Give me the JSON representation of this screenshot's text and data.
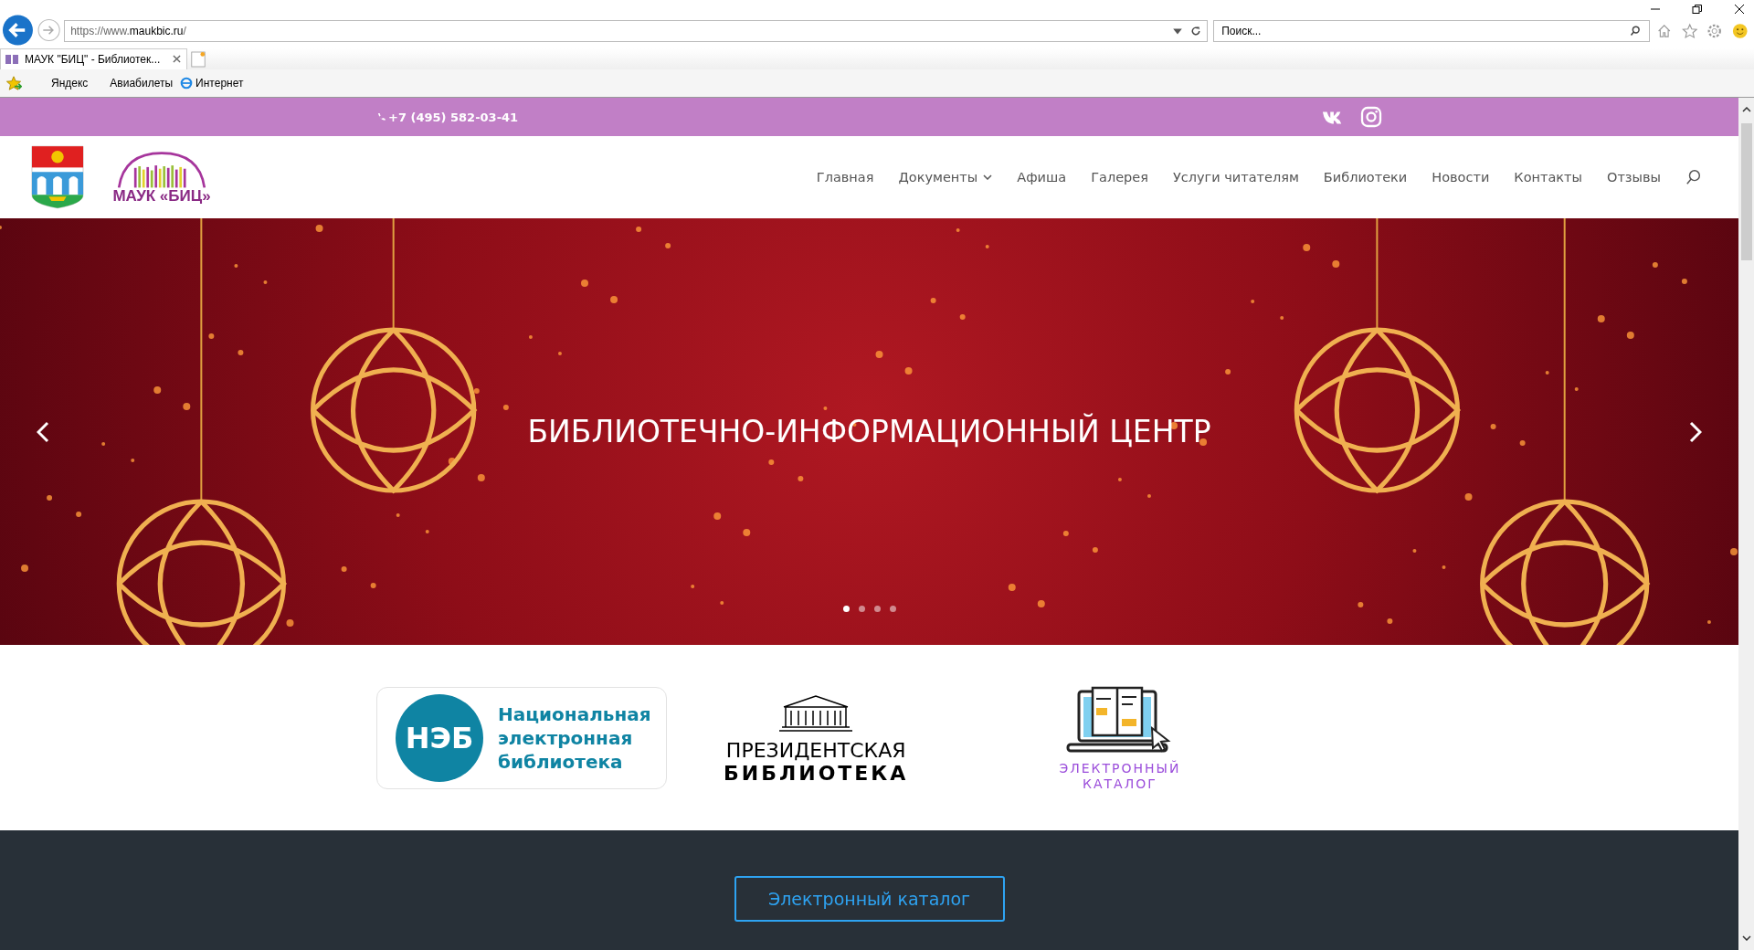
{
  "browser": {
    "url": "https://www.**maukbic.ru**/",
    "search_placeholder": "Поиск...",
    "tabs": [
      {
        "title": "МАУК \"БИЦ\" - Библиотек...",
        "selected": true
      }
    ],
    "favorites": [
      {
        "label": "Яндекс",
        "kind": "plain"
      },
      {
        "label": "Авиабилеты",
        "kind": "plain"
      },
      {
        "label": "Интернет",
        "kind": "ie"
      }
    ]
  },
  "top_bar": {
    "phone": "+7 (495) 582-03-41"
  },
  "header": {
    "logo_text": "МАУК «БИЦ»",
    "nav": [
      {
        "label": "Главная",
        "kind": "link"
      },
      {
        "label": "Документы",
        "kind": "dropdown"
      },
      {
        "label": "Афиша",
        "kind": "link"
      },
      {
        "label": "Галерея",
        "kind": "link"
      },
      {
        "label": "Услуги читателям",
        "kind": "link"
      },
      {
        "label": "Библиотеки",
        "kind": "link"
      },
      {
        "label": "Новости",
        "kind": "link"
      },
      {
        "label": "Контакты",
        "kind": "link"
      },
      {
        "label": "Отзывы",
        "kind": "link"
      }
    ]
  },
  "hero": {
    "title": "БИБЛИОТЕЧНО-ИНФОРМАЦИОННЫЙ ЦЕНТР",
    "dots": [
      {
        "selected": true
      },
      {
        "selected": false
      },
      {
        "selected": false
      },
      {
        "selected": false
      }
    ]
  },
  "partners": {
    "neb": {
      "badge": "НЭБ",
      "lines": [
        "Национальная",
        "электронная",
        "библиотека"
      ]
    },
    "presidential": {
      "line_1": "ПРЕЗИДЕНТСКАЯ",
      "line_2": "БИБЛИОТЕКА"
    },
    "catalog": {
      "line_1": "ЭЛЕКТРОННЫЙ",
      "line_2": "КАТАЛОГ"
    }
  },
  "footer_section": {
    "button": "Электронный каталог"
  }
}
